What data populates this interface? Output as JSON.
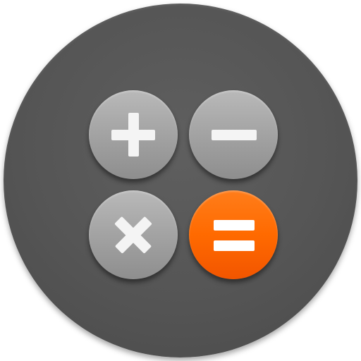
{
  "app": {
    "name": "Calculator"
  },
  "keys": [
    {
      "id": "plus",
      "icon": "plus-icon",
      "style": "gray"
    },
    {
      "id": "minus",
      "icon": "minus-icon",
      "style": "gray"
    },
    {
      "id": "times",
      "icon": "multiply-icon",
      "style": "gray"
    },
    {
      "id": "equals",
      "icon": "equals-icon",
      "style": "accent"
    }
  ],
  "colors": {
    "background_disc": "#555555",
    "key_gray": "#a5a5a5",
    "key_accent": "#ff6a00",
    "glyph": "#ffffff"
  }
}
